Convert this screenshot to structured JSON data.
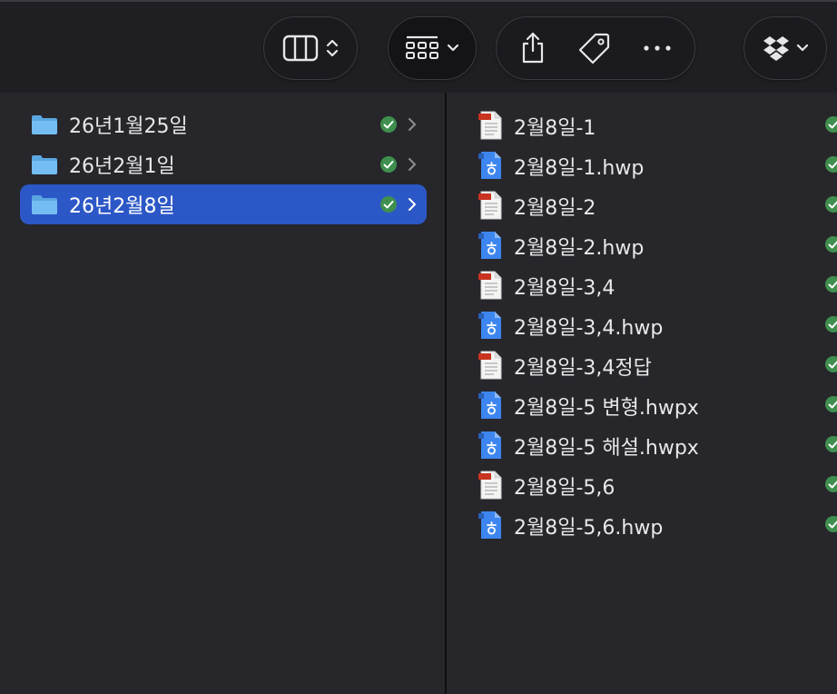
{
  "toolbar": {
    "view_toggle_icon": "column-view-icon",
    "view_toggle_chevron": "chevron-updown-icon",
    "group_icon": "grid-group-icon",
    "group_chevron": "chevron-down-icon",
    "share_icon": "share-icon",
    "tag_icon": "tag-icon",
    "more_icon": "ellipsis-icon",
    "dropbox_icon": "dropbox-icon",
    "dropbox_chevron": "chevron-down-icon"
  },
  "colors": {
    "selection": "#2c57c7",
    "sync_ok": "#3f8f4e",
    "folder": "#6cb8f0",
    "hwp_icon": "#3d86f0",
    "doc_tab": "#c8341f"
  },
  "folders": [
    {
      "name": "26년1월25일",
      "selected": false,
      "sync": "synced"
    },
    {
      "name": "26년2월1일",
      "selected": false,
      "sync": "synced"
    },
    {
      "name": "26년2월8일",
      "selected": true,
      "sync": "synced"
    }
  ],
  "files": [
    {
      "name": "2월8일-1",
      "kind": "doc"
    },
    {
      "name": "2월8일-1.hwp",
      "kind": "hwp"
    },
    {
      "name": "2월8일-2",
      "kind": "doc"
    },
    {
      "name": "2월8일-2.hwp",
      "kind": "hwp"
    },
    {
      "name": "2월8일-3,4",
      "kind": "doc"
    },
    {
      "name": "2월8일-3,4.hwp",
      "kind": "hwp"
    },
    {
      "name": "2월8일-3,4정답",
      "kind": "doc"
    },
    {
      "name": "2월8일-5 변형.hwpx",
      "kind": "hwp"
    },
    {
      "name": "2월8일-5 해설.hwpx",
      "kind": "hwp"
    },
    {
      "name": "2월8일-5,6",
      "kind": "doc"
    },
    {
      "name": "2월8일-5,6.hwp",
      "kind": "hwp"
    }
  ]
}
